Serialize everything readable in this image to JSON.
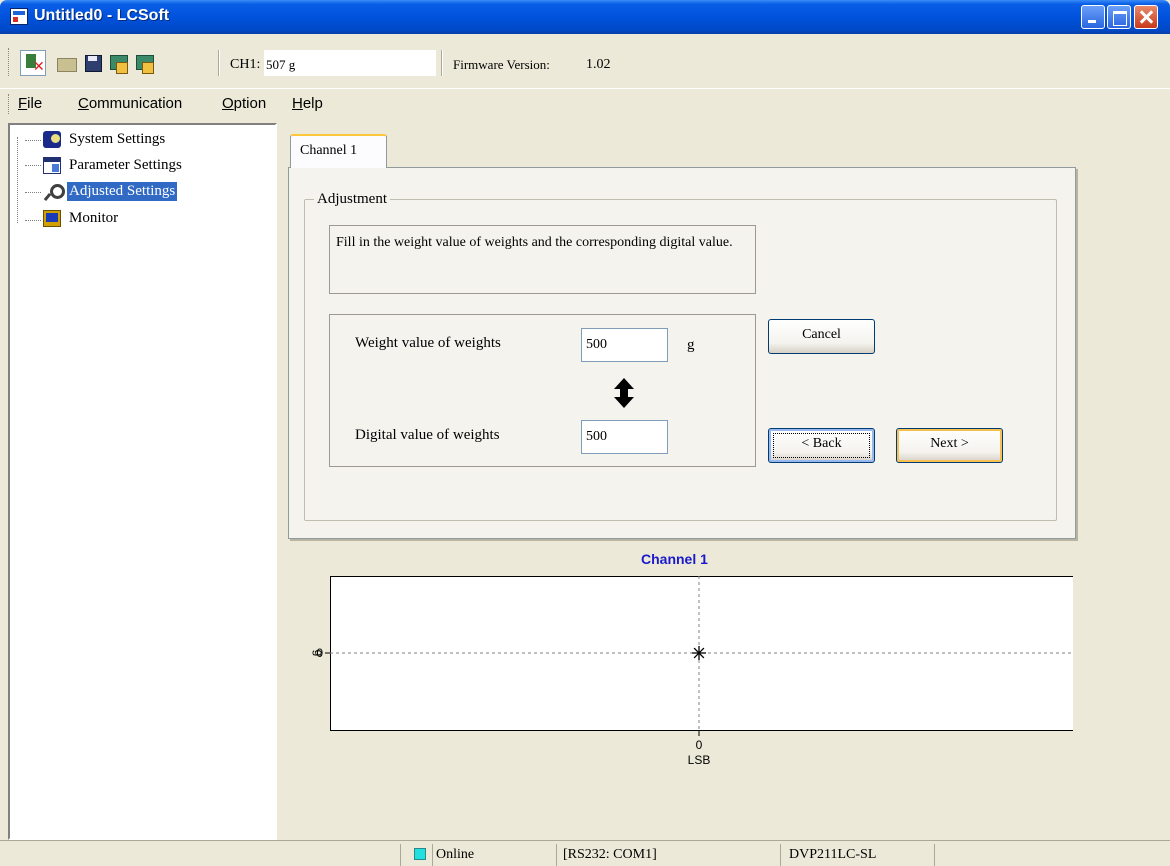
{
  "window": {
    "title": "Untitled0 - LCSoft"
  },
  "toolbar": {
    "ch1_label": "CH1:",
    "ch1_value": "507 g",
    "firmware_label": "Firmware Version:",
    "firmware_value": "1.02",
    "icons": [
      "disconnect-icon",
      "open-folder-icon",
      "save-icon",
      "upload-icon",
      "download-icon"
    ]
  },
  "menu": [
    {
      "underline": "F",
      "rest": "ile"
    },
    {
      "underline": "C",
      "rest": "ommunication"
    },
    {
      "underline": "O",
      "rest": "ption"
    },
    {
      "underline": "H",
      "rest": "elp"
    }
  ],
  "tree": [
    {
      "label": "System Settings",
      "icon": "system-settings-icon",
      "selected": false
    },
    {
      "label": "Parameter Settings",
      "icon": "parameter-settings-icon",
      "selected": false
    },
    {
      "label": "Adjusted Settings",
      "icon": "adjusted-settings-icon",
      "selected": true
    },
    {
      "label": "Monitor",
      "icon": "monitor-icon",
      "selected": false
    }
  ],
  "panel": {
    "tab_label": "Channel 1",
    "group_title": "Adjustment",
    "instructions": "Fill in the weight value of weights and the corresponding digital value.",
    "weight_label": "Weight value of weights",
    "weight_value": "500",
    "weight_unit": "g",
    "digital_label": "Digital value of weights",
    "digital_value": "500",
    "cancel_label": "Cancel",
    "back_label": "< Back",
    "next_label": "Next >"
  },
  "chart_data": {
    "type": "scatter",
    "title": "Channel 1",
    "xlabel": "LSB",
    "ylabel": "g",
    "x_ticks": [
      "0"
    ],
    "y_ticks": [
      "0"
    ],
    "points": [
      {
        "x": 0,
        "y": 0
      }
    ],
    "marker": "asterisk",
    "crosshair_color": "#808080",
    "title_color": "#1a1acc"
  },
  "status": {
    "online_text": "Online",
    "online_color": "#22e0e0",
    "port": "[RS232: COM1]",
    "device": "DVP211LC-SL"
  }
}
